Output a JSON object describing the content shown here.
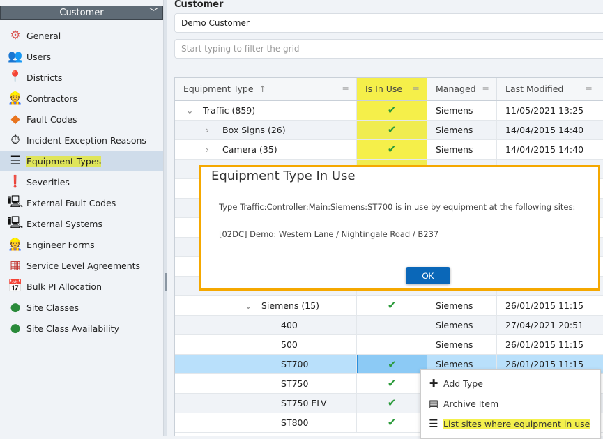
{
  "sidebar": {
    "title": "Customer",
    "items": [
      {
        "label": "General",
        "icon": "gear-icon",
        "active": false
      },
      {
        "label": "Users",
        "icon": "users-icon",
        "active": false
      },
      {
        "label": "Districts",
        "icon": "map-pin-icon",
        "active": false
      },
      {
        "label": "Contractors",
        "icon": "worker-icon",
        "active": false
      },
      {
        "label": "Fault Codes",
        "icon": "fault-diamond-icon",
        "active": false
      },
      {
        "label": "Incident Exception Reasons",
        "icon": "stopwatch-icon",
        "active": false
      },
      {
        "label": "Equipment Types",
        "icon": "list-icon",
        "active": true
      },
      {
        "label": "Severities",
        "icon": "exclamation-icon",
        "active": false
      },
      {
        "label": "External Fault Codes",
        "icon": "computer-fault-icon",
        "active": false
      },
      {
        "label": "External Systems",
        "icon": "computer-icon",
        "active": false
      },
      {
        "label": "Engineer Forms",
        "icon": "worker-icon",
        "active": false
      },
      {
        "label": "Service Level Agreements",
        "icon": "sla-grid-icon",
        "active": false
      },
      {
        "label": "Bulk PI Allocation",
        "icon": "calendar-user-icon",
        "active": false
      },
      {
        "label": "Site Classes",
        "icon": "spheres-icon",
        "active": false
      },
      {
        "label": "Site Class Availability",
        "icon": "spheres-icon",
        "active": false
      }
    ]
  },
  "customer": {
    "label": "Customer",
    "value": "Demo Customer"
  },
  "filter": {
    "placeholder": "Start typing to filter the grid"
  },
  "grid": {
    "columns": [
      {
        "label": "Equipment Type",
        "sort": "↑"
      },
      {
        "label": "Is In Use"
      },
      {
        "label": "Managed"
      },
      {
        "label": "Last Modified"
      }
    ],
    "rows": [
      {
        "type": "Traffic  (859)",
        "expander": "⌄",
        "level": 0,
        "in_use": true,
        "managed": "Siemens",
        "modified": "11/05/2021 13:25"
      },
      {
        "type": "Box Signs  (26)",
        "expander": "›",
        "level": 1,
        "in_use": true,
        "managed": "Siemens",
        "modified": "14/04/2015 14:40"
      },
      {
        "type": "Camera  (35)",
        "expander": "›",
        "level": 1,
        "in_use": true,
        "managed": "Siemens",
        "modified": "14/04/2015 14:40"
      },
      {
        "type": "Siemens  (15)",
        "expander": "⌄",
        "level": 3,
        "in_use": true,
        "managed": "Siemens",
        "modified": "26/01/2015 11:15"
      },
      {
        "type": "400",
        "level": 4,
        "in_use": false,
        "managed": "Siemens",
        "modified": "27/04/2021 20:51"
      },
      {
        "type": "500",
        "level": 4,
        "in_use": false,
        "managed": "Siemens",
        "modified": "26/01/2015 11:15"
      },
      {
        "type": "ST700",
        "level": 4,
        "in_use": true,
        "managed": "Siemens",
        "modified": "26/01/2015 11:15",
        "selected": true
      },
      {
        "type": "ST750",
        "level": 4,
        "in_use": true,
        "managed": "Siemens",
        "modified": ""
      },
      {
        "type": "ST750 ELV",
        "level": 4,
        "in_use": true,
        "managed": "",
        "modified": ""
      },
      {
        "type": "ST800",
        "level": 4,
        "in_use": true,
        "managed": "",
        "modified": ""
      }
    ]
  },
  "dialog": {
    "title": "Equipment Type In Use",
    "message": "Type Traffic:Controller:Main:Siemens:ST700 is in use by equipment at the following sites:",
    "site": "[02DC] Demo: Western Lane / Nightingale Road / B237",
    "ok_label": "OK"
  },
  "context_menu": {
    "items": [
      {
        "label": "Add Type",
        "icon": "plus-icon"
      },
      {
        "label": "Archive Item",
        "icon": "archive-icon"
      },
      {
        "label": "List sites where equipment in use",
        "icon": "list-icon",
        "highlighted": true
      }
    ]
  },
  "colors": {
    "highlight": "#f5ef4a",
    "selection": "#b9e0fb",
    "dialog_border": "#f5a800",
    "ok_button": "#0a67b8",
    "checkmark": "#2a9a3a"
  }
}
